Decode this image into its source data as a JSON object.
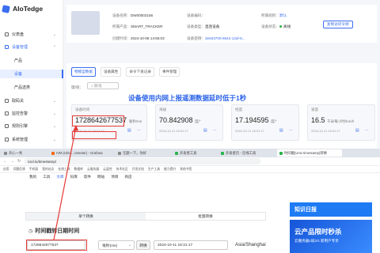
{
  "app": {
    "name": "AIoTedge"
  },
  "sidebar": {
    "items": [
      {
        "label": "仪表盘"
      },
      {
        "label": "设备管理"
      },
      {
        "label": "产品"
      },
      {
        "label": "设备"
      },
      {
        "label": "产品选类"
      },
      {
        "label": "取码关"
      },
      {
        "label": "监控告警"
      },
      {
        "label": "规则引擎"
      },
      {
        "label": "系统管理"
      }
    ]
  },
  "device": {
    "id_label": "设备名称：",
    "id_value": "DW00002156",
    "product_label": "所属产品：",
    "product_value": "SMART_TRACKER",
    "created_label": "创建时间：",
    "created_value": "2024-10-08 14:55:03",
    "code_label": "设备编码：",
    "code_value": "",
    "type_label": "设备类型：",
    "type_value": "直连设备",
    "key_label": "设备密钥：",
    "key_value": "3e633700-8542-12af-8...",
    "group_label": "所属组织：",
    "group_value": "默认",
    "status_label": "设备状态：",
    "status_value": "离线",
    "action_button": "复制访问令牌"
  },
  "tabs": [
    "物模型数据",
    "设备属性",
    "命令下发记录",
    "事件管理"
  ],
  "filter": {
    "label": "键/值：",
    "placeholder": "键/值"
  },
  "overlay_note": "设备使用内网上报遥测数据延时低于1秒",
  "metrics": [
    {
      "label": "设备时间",
      "value": "1728642677537",
      "unit": "毫秒/ms",
      "time": "2024-10-11 18:31:17"
    },
    {
      "label": "海拔",
      "value": "70.842908",
      "unit": "度/°",
      "time": "2024-10-11 18:31:17"
    },
    {
      "label": "经度",
      "value": "17.194595",
      "unit": "度/°",
      "time": "2024-10-11 18:31:17"
    },
    {
      "label": "速度",
      "value": "16.5",
      "unit": "千米每小时/km/h",
      "time": "2024-10-11 18:31:17"
    }
  ],
  "browser": {
    "tabs": [
      "开心一秀",
      "IVM (Ultra...rameter) - Grafana",
      "无题一下，你好",
      "开发者工具",
      "开发者页 - 在线工具",
      "时间戳(Unix timestamp)转换"
    ],
    "url": "tool.lu/timestamp/",
    "bookmarks": [
      "应用",
      "问题反馈",
      "手机版",
      "我的站点",
      "在线工具",
      "数据库",
      "云服务器",
      "云监控",
      "技术社区",
      "开发文档",
      "生产工具",
      "能力提升",
      "其他书签"
    ],
    "site_nav": [
      "我的",
      "工具",
      "文库",
      "码库",
      "软件",
      "网站",
      "项目",
      "商店"
    ],
    "site_nav_highlight": "文库",
    "seg_left": "单个转换",
    "seg_right": "批量转换",
    "section_title": "时间戳转日期时间",
    "ts_input": "1728642677537",
    "unit_select": "毫秒(ms)",
    "convert_button": "转换",
    "result": "2024-10-11 18:31:17",
    "timezone": "Asia/Shanghai",
    "ad1": "知识日报",
    "ad2_title": "云产品限时秒杀",
    "ad2_sub": "云服务器1核2G 新用户专享"
  },
  "colors": {
    "accent": "#3a6df0",
    "annotation_red": "#e53935",
    "note_blue": "#2a62e8"
  }
}
